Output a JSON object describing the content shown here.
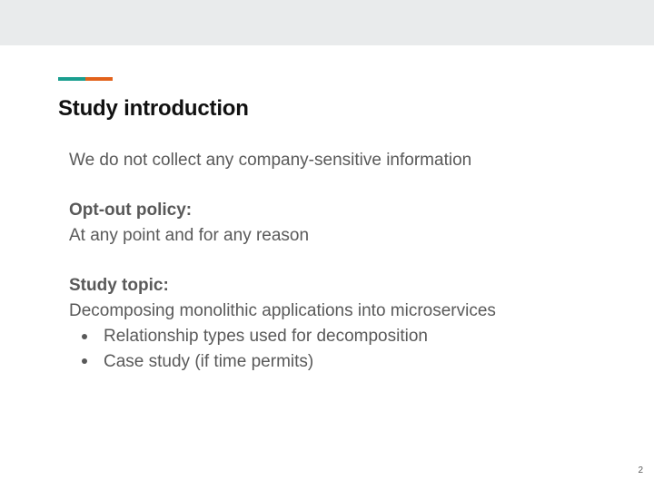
{
  "slide": {
    "title": "Study introduction",
    "accent_colors": [
      "#1a9e8f",
      "#e2621b"
    ],
    "lines": [
      "We do not collect any company-sensitive information",
      "Opt-out policy:",
      "At any point and for any reason",
      "Study topic:",
      "Decomposing monolithic applications into microservices"
    ],
    "bullets": [
      "Relationship types used for decomposition",
      "Case study (if time permits)"
    ],
    "page_number": "2"
  }
}
